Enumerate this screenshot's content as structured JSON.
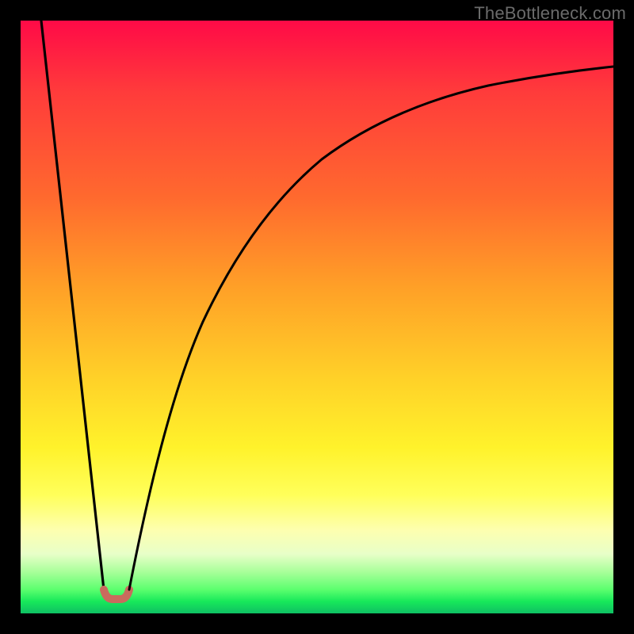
{
  "watermark": {
    "text": "TheBottleneck.com"
  },
  "chart_data": {
    "type": "line",
    "title": "",
    "xlabel": "",
    "ylabel": "",
    "xlim": [
      0,
      100
    ],
    "ylim": [
      0,
      100
    ],
    "grid": false,
    "legend": false,
    "series": [
      {
        "name": "left-descending-line",
        "x": [
          3.5,
          14
        ],
        "values": [
          100,
          4
        ]
      },
      {
        "name": "right-growth-curve",
        "x": [
          18,
          22,
          26,
          30,
          35,
          40,
          45,
          50,
          55,
          60,
          65,
          70,
          75,
          80,
          85,
          90,
          95,
          100
        ],
        "values": [
          4,
          17,
          30,
          41,
          52,
          61,
          67.5,
          72.5,
          76.5,
          79.5,
          82,
          84,
          85.8,
          87.3,
          88.5,
          89.5,
          90.3,
          91
        ]
      },
      {
        "name": "valley-marker",
        "x": [
          14,
          15,
          17,
          18
        ],
        "values": [
          4,
          2.8,
          2.8,
          4
        ]
      }
    ],
    "annotations": [
      {
        "name": "valley-segment-color",
        "color": "#c96b5d"
      }
    ]
  }
}
